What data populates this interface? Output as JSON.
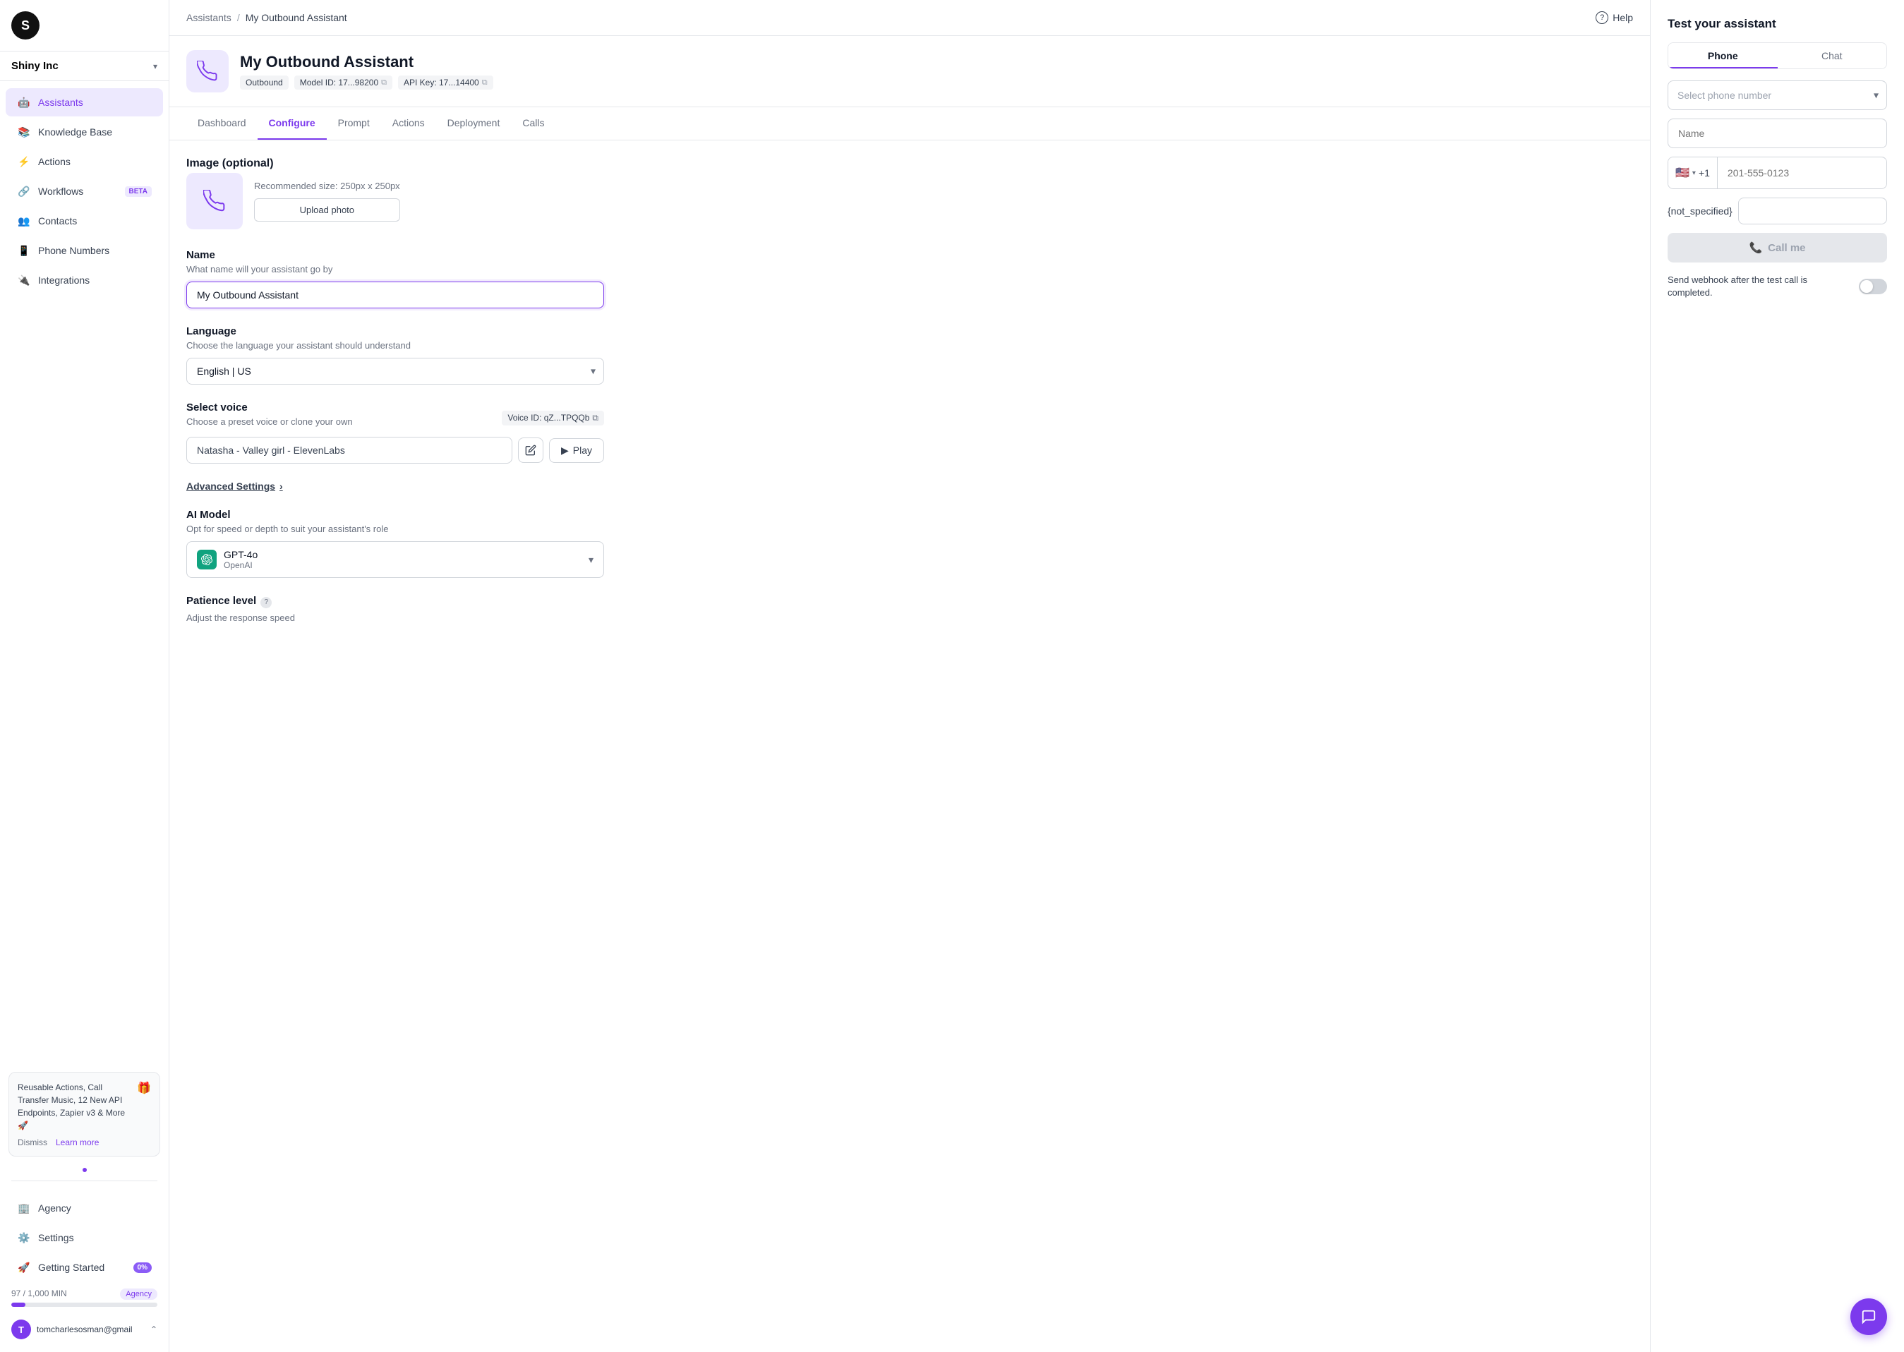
{
  "logo": {
    "letter": "S"
  },
  "company": {
    "name": "Shiny Inc",
    "chevron": "▾"
  },
  "sidebar": {
    "items": [
      {
        "id": "assistants",
        "label": "Assistants",
        "icon": "🤖",
        "active": true
      },
      {
        "id": "knowledge-base",
        "label": "Knowledge Base",
        "icon": "📚"
      },
      {
        "id": "actions",
        "label": "Actions",
        "icon": "⚡"
      },
      {
        "id": "workflows",
        "label": "Workflows",
        "icon": "🔗",
        "badge": "BETA"
      },
      {
        "id": "contacts",
        "label": "Contacts",
        "icon": "👥"
      },
      {
        "id": "phone-numbers",
        "label": "Phone Numbers",
        "icon": "📱"
      },
      {
        "id": "integrations",
        "label": "Integrations",
        "icon": "🔌"
      }
    ],
    "bottom_items": [
      {
        "id": "agency",
        "label": "Agency",
        "icon": "🏢"
      },
      {
        "id": "settings",
        "label": "Settings",
        "icon": "⚙️"
      },
      {
        "id": "getting-started",
        "label": "Getting Started",
        "icon": "🚀",
        "badge": "0%"
      }
    ]
  },
  "promo": {
    "text": "Reusable Actions, Call Transfer Music, 12 New API Endpoints, Zapier v3 & More 🚀",
    "dismiss": "Dismiss",
    "learn_more": "Learn more"
  },
  "usage": {
    "label": "97 / 1,000 MIN",
    "badge": "Agency",
    "percent": 9.7
  },
  "user": {
    "initial": "T",
    "email": "tomcharlesosman@gmail"
  },
  "breadcrumb": {
    "parent": "Assistants",
    "separator": "/",
    "current": "My Outbound Assistant"
  },
  "help_label": "Help",
  "assistant": {
    "name": "My Outbound Assistant",
    "type": "Outbound",
    "model_id": "Model ID: 17...98200",
    "api_key": "API Key: 17...14400"
  },
  "tabs": [
    {
      "id": "dashboard",
      "label": "Dashboard"
    },
    {
      "id": "configure",
      "label": "Configure",
      "active": true
    },
    {
      "id": "prompt",
      "label": "Prompt"
    },
    {
      "id": "actions",
      "label": "Actions"
    },
    {
      "id": "deployment",
      "label": "Deployment"
    },
    {
      "id": "calls",
      "label": "Calls"
    }
  ],
  "configure": {
    "image_section": {
      "title": "Image (optional)",
      "hint": "Recommended size: 250px x 250px",
      "upload_btn": "Upload photo"
    },
    "name_section": {
      "title": "Name",
      "hint": "What name will your assistant go by",
      "value": "My Outbound Assistant",
      "placeholder": "My Outbound Assistant"
    },
    "language_section": {
      "title": "Language",
      "hint": "Choose the language your assistant should understand",
      "value": "English | US"
    },
    "voice_section": {
      "title": "Select voice",
      "hint": "Choose a preset voice or clone your own",
      "voice_id": "Voice ID: qZ...TPQQb",
      "voice_name": "Natasha - Valley girl - ElevenLabs",
      "play_label": "Play"
    },
    "advanced_settings": "Advanced Settings",
    "ai_model_section": {
      "title": "AI Model",
      "hint": "Opt for speed or depth to suit your assistant's role",
      "model_name": "GPT-4o",
      "provider": "OpenAI"
    },
    "patience_section": {
      "title": "Patience level",
      "hint": "Adjust the response speed"
    }
  },
  "right_panel": {
    "title": "Test your assistant",
    "tabs": [
      {
        "id": "phone",
        "label": "Phone",
        "active": true
      },
      {
        "id": "chat",
        "label": "Chat"
      }
    ],
    "phone_select_placeholder": "Select phone number",
    "name_placeholder": "Name",
    "phone_placeholder": "201-555-0123",
    "country_code": "+1",
    "flag": "🇺🇸",
    "not_specified_label": "{not_specified}",
    "call_me_btn": "Call me",
    "webhook_text": "Send webhook after the test call is completed."
  }
}
